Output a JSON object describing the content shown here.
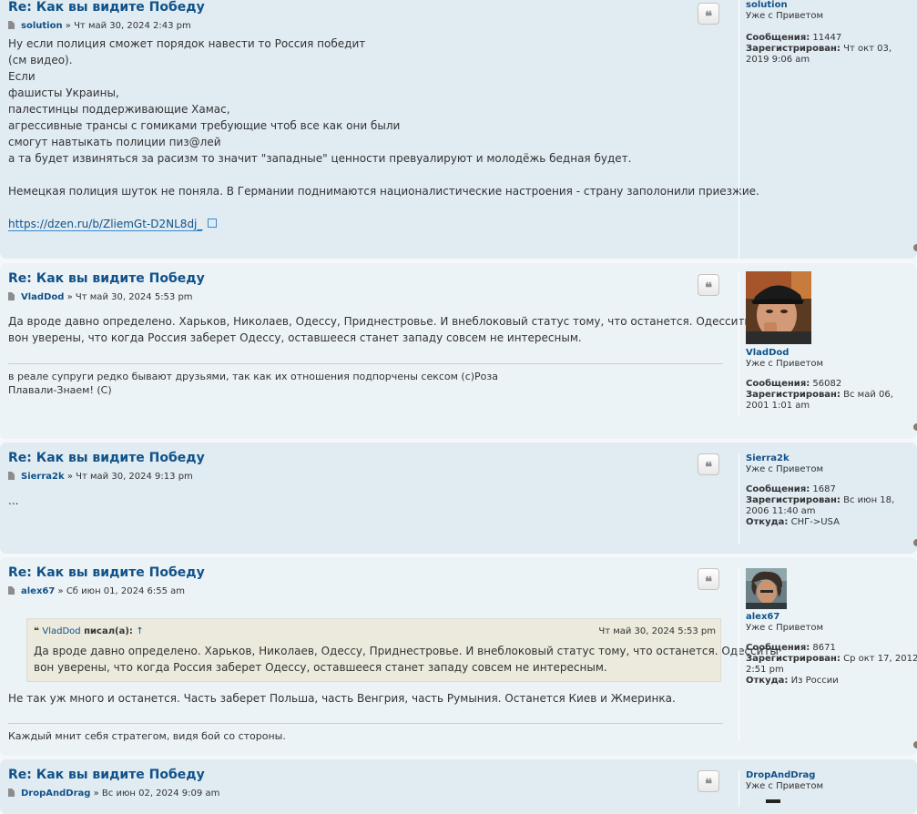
{
  "topic_title": "Re: Как вы видите Победу",
  "date_separator": "»",
  "quote_icon": "quote-icon",
  "labels": {
    "posts": "Сообщения:",
    "registered": "Зарегистрирован:",
    "from": "Откуда:"
  },
  "posts": [
    {
      "author": "solution",
      "date": "Чт май 30, 2024 2:43 pm",
      "body": [
        "Ну если полиция сможет порядок навести то Россия победит",
        "(см видео).",
        "Если",
        "фашисты Украины,",
        "палестинцы поддерживающие Хамас,",
        "агрессивные трансы с гомиками требующие чтоб все как они были",
        "смогут навтыкать полиции пиз@лей",
        "а та будет извиняться за расизм то значит \"западные\" ценности превуалируют и молодёжь бедная будет.",
        "",
        "Немецкая полиция шуток не поняла. В Германии поднимаются националистические настроения - страну заполонили приезжие.",
        ""
      ],
      "link": "https://dzen.ru/b/ZliemGt-D2NL8dj_",
      "rank": "Уже с Приветом",
      "post_count": "11447",
      "registered": "Чт окт 03, 2019 9:06 am"
    },
    {
      "author": "VladDod",
      "date": "Чт май 30, 2024 5:53 pm",
      "body": [
        "Да вроде давно определено. Харьков, Николаев, Одессу, Приднестровье. И внеблоковый статус тому, что останется. Одесситы",
        "вон уверены, что когда Россия заберет Одессу, оставшееся станет западу совсем не интересным."
      ],
      "signature": [
        "в реале супруги редко бывают друзьями, так как их отношения подпорчены сексом (с)Роза",
        "Плавали-Знаем! (С)"
      ],
      "rank": "Уже с Приветом",
      "post_count": "56082",
      "registered": "Вс май 06, 2001 1:01 am"
    },
    {
      "author": "Sierra2k",
      "date": "Чт май 30, 2024 9:13 pm",
      "body": [
        "..."
      ],
      "rank": "Уже с Приветом",
      "post_count": "1687",
      "registered": "Вс июн 18, 2006 11:40 am",
      "location": "СНГ->USA"
    },
    {
      "author": "alex67",
      "date": "Сб июн 01, 2024 6:55 am",
      "quote": {
        "author": "VladDod",
        "wrote": "писал(а):",
        "arrow": "↑",
        "date": "Чт май 30, 2024 5:53 pm",
        "text": [
          "Да вроде давно определено. Харьков, Николаев, Одессу, Приднестровье. И внеблоковый статус тому, что останется. Одесситы",
          "вон уверены, что когда Россия заберет Одессу, оставшееся станет западу совсем не интересным."
        ]
      },
      "body": [
        "Не так уж много и останется. Часть заберет Польша, часть Венгрия, часть Румыния. Останется Киев и Жмеринка."
      ],
      "signature": [
        "Каждый мнит себя стратегом, видя бой со стороны."
      ],
      "rank": "Уже с Приветом",
      "post_count": "8671",
      "registered": "Ср окт 17, 2012 2:51 pm",
      "location": "Из России"
    },
    {
      "author": "DropAndDrag",
      "date": "Вс июн 02, 2024 9:09 am",
      "rank": "Уже с Приветом"
    }
  ]
}
